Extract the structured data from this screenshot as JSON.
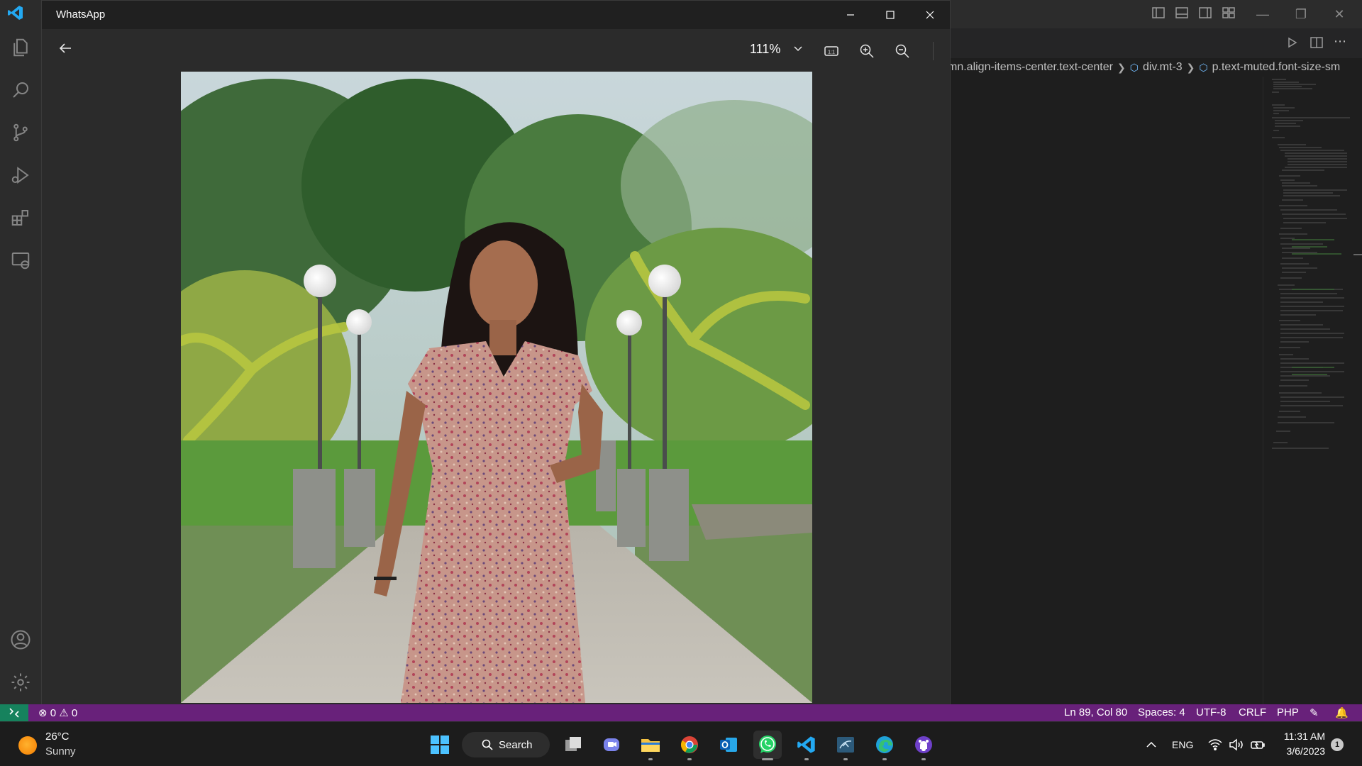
{
  "whatsapp": {
    "title": "WhatsApp",
    "zoom": "111%",
    "actual_size_label": "1:1"
  },
  "vscode": {
    "breadcrumb": [
      "mn.align-items-center.text-center",
      "div.mt-3",
      "p.text-muted.font-size-sm"
    ]
  },
  "statusbar": {
    "errors": "0",
    "warnings": "0",
    "position": "Ln 89, Col 80",
    "spaces": "Spaces: 4",
    "encoding": "UTF-8",
    "eol": "CRLF",
    "language": "PHP"
  },
  "taskbar": {
    "weather": {
      "temp": "26°C",
      "condition": "Sunny"
    },
    "search_label": "Search",
    "language": "ENG",
    "time": "11:31 AM",
    "date": "3/6/2023",
    "notification_count": "1"
  },
  "colors": {
    "statusbar": "#68217a",
    "remote_indicator": "#16825d",
    "whatsapp_green": "#25d366",
    "vscode_blue": "#23a9f2"
  }
}
